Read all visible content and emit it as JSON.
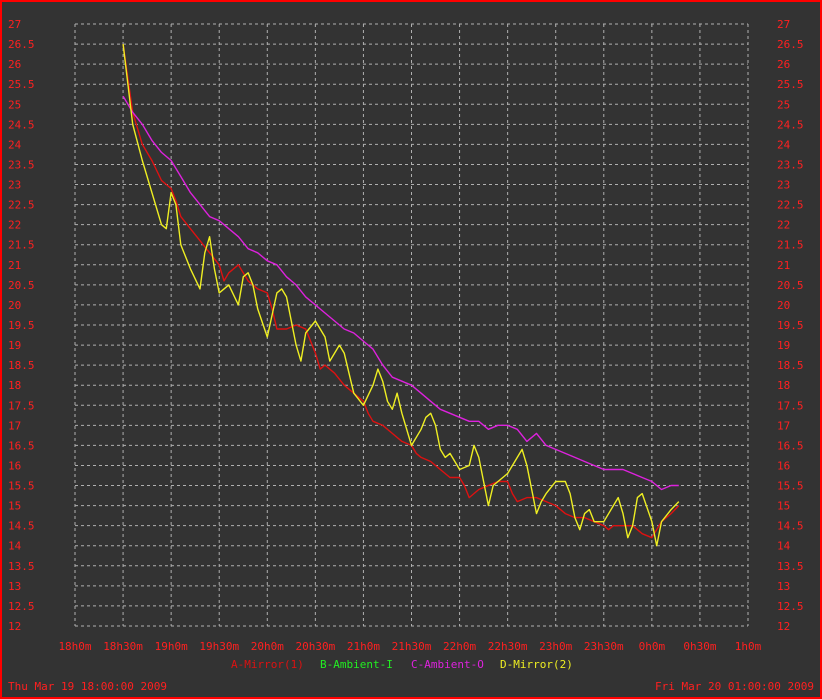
{
  "chart_data": {
    "type": "line",
    "x_tick_labels": [
      "18h0m",
      "18h30m",
      "19h0m",
      "19h30m",
      "20h0m",
      "20h30m",
      "21h0m",
      "21h30m",
      "22h0m",
      "22h30m",
      "23h0m",
      "23h30m",
      "0h0m",
      "0h30m",
      "1h0m"
    ],
    "x_tick_hours": [
      0,
      0.5,
      1,
      1.5,
      2,
      2.5,
      3,
      3.5,
      4,
      4.5,
      5,
      5.5,
      6,
      6.5,
      7
    ],
    "xlim_hours": [
      0,
      7
    ],
    "ylim": [
      12,
      27
    ],
    "y_tick_labels": [
      "12",
      "12.5",
      "13",
      "13.5",
      "14",
      "14.5",
      "15",
      "15.5",
      "16",
      "16.5",
      "17",
      "17.5",
      "18",
      "18.5",
      "19",
      "19.5",
      "20",
      "20.5",
      "21",
      "21.5",
      "22",
      "22.5",
      "23",
      "23.5",
      "24",
      "24.5",
      "25",
      "25.5",
      "26",
      "26.5",
      "27"
    ],
    "y_ticks": [
      12,
      12.5,
      13,
      13.5,
      14,
      14.5,
      15,
      15.5,
      16,
      16.5,
      17,
      17.5,
      18,
      18.5,
      19,
      19.5,
      20,
      20.5,
      21,
      21.5,
      22,
      22.5,
      23,
      23.5,
      24,
      24.5,
      25,
      25.5,
      26,
      26.5,
      27
    ],
    "grid": true,
    "legend_position": "bottom",
    "start_label": "Thu Mar 19 18:00:00 2009",
    "end_label": "Fri Mar 20 01:00:00 2009",
    "series": [
      {
        "name": "A-Mirror(1)",
        "color": "#dd1111",
        "x": [
          0.5,
          0.6,
          0.7,
          0.8,
          0.9,
          1.0,
          1.05,
          1.1,
          1.2,
          1.3,
          1.4,
          1.5,
          1.55,
          1.6,
          1.7,
          1.8,
          1.9,
          2.0,
          2.05,
          2.1,
          2.2,
          2.3,
          2.4,
          2.5,
          2.55,
          2.6,
          2.7,
          2.8,
          2.9,
          3.0,
          3.05,
          3.1,
          3.2,
          3.3,
          3.4,
          3.5,
          3.55,
          3.6,
          3.7,
          3.8,
          3.9,
          4.0,
          4.05,
          4.1,
          4.2,
          4.3,
          4.4,
          4.5,
          4.55,
          4.6,
          4.7,
          4.8,
          4.9,
          5.0,
          5.05,
          5.1,
          5.2,
          5.3,
          5.4,
          5.5,
          5.55,
          5.6,
          5.7,
          5.8,
          5.9,
          6.0,
          6.05,
          6.1,
          6.2,
          6.28
        ],
        "y": [
          26.5,
          24.8,
          24.0,
          23.6,
          23.1,
          22.9,
          22.6,
          22.2,
          21.9,
          21.6,
          21.3,
          21.0,
          20.6,
          20.8,
          21.0,
          20.6,
          20.4,
          20.3,
          19.9,
          19.4,
          19.4,
          19.5,
          19.4,
          18.8,
          18.4,
          18.5,
          18.3,
          18.0,
          17.8,
          17.6,
          17.3,
          17.1,
          17.0,
          16.8,
          16.6,
          16.5,
          16.3,
          16.2,
          16.1,
          15.9,
          15.7,
          15.7,
          15.5,
          15.2,
          15.4,
          15.5,
          15.6,
          15.6,
          15.3,
          15.1,
          15.2,
          15.2,
          15.1,
          15.0,
          14.9,
          14.8,
          14.7,
          14.7,
          14.6,
          14.5,
          14.4,
          14.5,
          14.5,
          14.5,
          14.3,
          14.2,
          14.4,
          14.6,
          14.8,
          15.0
        ]
      },
      {
        "name": "B-Ambient-I",
        "color": "#22ee22",
        "x": [],
        "y": []
      },
      {
        "name": "C-Ambient-O",
        "color": "#dd22dd",
        "x": [
          0.5,
          0.6,
          0.7,
          0.8,
          0.9,
          1.0,
          1.1,
          1.2,
          1.3,
          1.4,
          1.5,
          1.6,
          1.7,
          1.8,
          1.9,
          2.0,
          2.1,
          2.2,
          2.3,
          2.4,
          2.5,
          2.6,
          2.7,
          2.8,
          2.9,
          3.0,
          3.1,
          3.2,
          3.3,
          3.4,
          3.5,
          3.6,
          3.7,
          3.8,
          3.9,
          4.0,
          4.1,
          4.2,
          4.3,
          4.4,
          4.5,
          4.6,
          4.7,
          4.8,
          4.9,
          5.0,
          5.1,
          5.2,
          5.3,
          5.4,
          5.5,
          5.6,
          5.7,
          5.8,
          5.9,
          6.0,
          6.1,
          6.2,
          6.28
        ],
        "y": [
          25.2,
          24.8,
          24.5,
          24.1,
          23.8,
          23.6,
          23.2,
          22.8,
          22.5,
          22.2,
          22.1,
          21.9,
          21.7,
          21.4,
          21.3,
          21.1,
          21.0,
          20.7,
          20.5,
          20.2,
          20.0,
          19.8,
          19.6,
          19.4,
          19.3,
          19.1,
          18.9,
          18.5,
          18.2,
          18.1,
          18.0,
          17.8,
          17.6,
          17.4,
          17.3,
          17.2,
          17.1,
          17.1,
          16.9,
          17.0,
          17.0,
          16.9,
          16.6,
          16.8,
          16.5,
          16.4,
          16.3,
          16.2,
          16.1,
          16.0,
          15.9,
          15.9,
          15.9,
          15.8,
          15.7,
          15.6,
          15.4,
          15.5,
          15.5
        ]
      },
      {
        "name": "D-Mirror(2)",
        "color": "#eeee22",
        "x": [
          0.5,
          0.55,
          0.6,
          0.7,
          0.8,
          0.9,
          0.95,
          1.0,
          1.05,
          1.1,
          1.2,
          1.3,
          1.35,
          1.4,
          1.45,
          1.5,
          1.6,
          1.7,
          1.75,
          1.8,
          1.85,
          1.9,
          2.0,
          2.1,
          2.15,
          2.2,
          2.25,
          2.3,
          2.35,
          2.4,
          2.5,
          2.6,
          2.65,
          2.7,
          2.75,
          2.8,
          2.85,
          2.9,
          3.0,
          3.1,
          3.15,
          3.2,
          3.25,
          3.3,
          3.35,
          3.4,
          3.5,
          3.6,
          3.65,
          3.7,
          3.75,
          3.8,
          3.85,
          3.9,
          4.0,
          4.1,
          4.15,
          4.2,
          4.25,
          4.3,
          4.35,
          4.4,
          4.5,
          4.6,
          4.65,
          4.7,
          4.75,
          4.8,
          4.85,
          4.9,
          5.0,
          5.1,
          5.15,
          5.2,
          5.25,
          5.3,
          5.35,
          5.4,
          5.5,
          5.6,
          5.65,
          5.7,
          5.75,
          5.8,
          5.85,
          5.9,
          6.0,
          6.05,
          6.1,
          6.2,
          6.28
        ],
        "y": [
          26.5,
          25.5,
          24.5,
          23.6,
          22.8,
          22.0,
          21.9,
          22.8,
          22.5,
          21.5,
          20.9,
          20.4,
          21.3,
          21.7,
          20.9,
          20.3,
          20.5,
          20.0,
          20.7,
          20.8,
          20.5,
          19.9,
          19.2,
          20.3,
          20.4,
          20.2,
          19.6,
          19.0,
          18.6,
          19.3,
          19.6,
          19.2,
          18.6,
          18.8,
          19.0,
          18.8,
          18.3,
          17.8,
          17.5,
          18.0,
          18.4,
          18.1,
          17.6,
          17.4,
          17.8,
          17.3,
          16.5,
          16.9,
          17.2,
          17.3,
          17.0,
          16.4,
          16.2,
          16.3,
          15.9,
          16.0,
          16.5,
          16.2,
          15.6,
          15.0,
          15.5,
          15.6,
          15.8,
          16.2,
          16.4,
          16.0,
          15.4,
          14.8,
          15.1,
          15.3,
          15.6,
          15.6,
          15.3,
          14.7,
          14.4,
          14.8,
          14.9,
          14.6,
          14.6,
          15.0,
          15.2,
          14.8,
          14.2,
          14.5,
          15.2,
          15.3,
          14.6,
          14.0,
          14.6,
          14.9,
          15.1
        ]
      }
    ]
  }
}
